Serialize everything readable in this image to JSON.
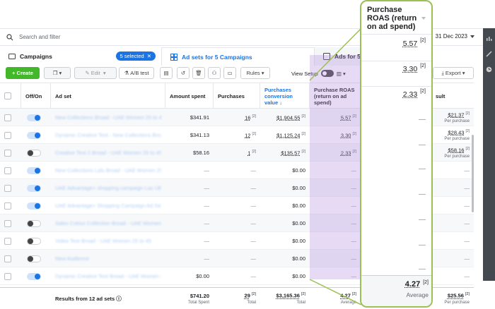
{
  "search": {
    "placeholder": "Search and filter"
  },
  "date_range": "31 Dec 2023",
  "tabs": {
    "campaigns": "Campaigns",
    "selected": "5 selected",
    "adsets": "Ad sets for 5 Campaigns",
    "ads": "Ads for 5"
  },
  "toolbar": {
    "create": "Create",
    "edit": "Edit",
    "ab_test": "A/B test",
    "rules": "Rules",
    "view_setup": "View Setup",
    "export": "Export"
  },
  "columns": {
    "offon": "Off/On",
    "adset": "Ad set",
    "amount": "Amount spent",
    "purchases": "Purchases",
    "pcv": "Purchases conversion value ↓",
    "roas": "Purchase ROAS (return on ad spend)",
    "result": "sult"
  },
  "rows": [
    {
      "name": "New Collections Broad - UAE Women 25 to 45",
      "on": true,
      "amount": "$341.91",
      "purchases": "16",
      "pcv": "$1,904.55",
      "roas": "5.57",
      "result": "$21.37",
      "result_sub": "Per purchase"
    },
    {
      "name": "Dynamic Creative Test - New Collections Broad",
      "on": true,
      "amount": "$341.13",
      "purchases": "12",
      "pcv": "$1,125.24",
      "roas": "3.30",
      "result": "$28.43",
      "result_sub": "Per purchase"
    },
    {
      "name": "Creative Test 2 Broad - UAE Women 25 to 45",
      "on": false,
      "amount": "$58.16",
      "purchases": "1",
      "pcv": "$135.57",
      "roas": "2.33",
      "result": "$58.16",
      "result_sub": "Per purchase"
    },
    {
      "name": "New Collections Lals Broad - UAE Women 25 to",
      "on": true,
      "amount": "—",
      "purchases": "—",
      "pcv": "$0.00",
      "roas": "—",
      "result": "—",
      "result_sub": ""
    },
    {
      "name": "UAE Advantage+ shopping campaign Las UEA",
      "on": true,
      "amount": "—",
      "purchases": "—",
      "pcv": "$0.00",
      "roas": "—",
      "result": "—",
      "result_sub": ""
    },
    {
      "name": "UAE Advantage+ Shopping Campaign Ad Set",
      "on": true,
      "amount": "—",
      "purchases": "—",
      "pcv": "$0.00",
      "roas": "—",
      "result": "—",
      "result_sub": ""
    },
    {
      "name": "Sales Colour Collection Broad - UAE Women 2",
      "on": false,
      "amount": "—",
      "purchases": "—",
      "pcv": "$0.00",
      "roas": "—",
      "result": "—",
      "result_sub": ""
    },
    {
      "name": "Video Test Broad - UAE Women 25 to 45",
      "on": false,
      "amount": "—",
      "purchases": "—",
      "pcv": "$0.00",
      "roas": "—",
      "result": "—",
      "result_sub": ""
    },
    {
      "name": "New Audience",
      "on": false,
      "amount": "—",
      "purchases": "—",
      "pcv": "$0.00",
      "roas": "—",
      "result": "—",
      "result_sub": ""
    },
    {
      "name": "Dynamic Creative Test Broad - UAE Women 2",
      "on": true,
      "amount": "$0.00",
      "purchases": "—",
      "pcv": "$0.00",
      "roas": "—",
      "result": "—",
      "result_sub": ""
    }
  ],
  "footer": {
    "label": "Results from 12 ad sets",
    "amount": "$741.20",
    "amount_sub": "Total Spent",
    "purchases": "29",
    "purchases_sub": "Total",
    "pcv": "$3,165.36",
    "pcv_sub": "Total",
    "roas": "4.27",
    "roas_sub": "Average",
    "result": "$25.56",
    "result_sub": "Per purchase"
  },
  "sup": "[2]",
  "zoom": {
    "title": "Purchase ROAS (return on ad spend)",
    "values": [
      "5.57",
      "3.30",
      "2.33"
    ],
    "dash": "—",
    "total": "4.27",
    "total_sub": "Average"
  },
  "colors": {
    "accent": "#1b74e4",
    "create": "#42b72a",
    "highlight": "#b08cdc",
    "callout": "#9bc053"
  }
}
